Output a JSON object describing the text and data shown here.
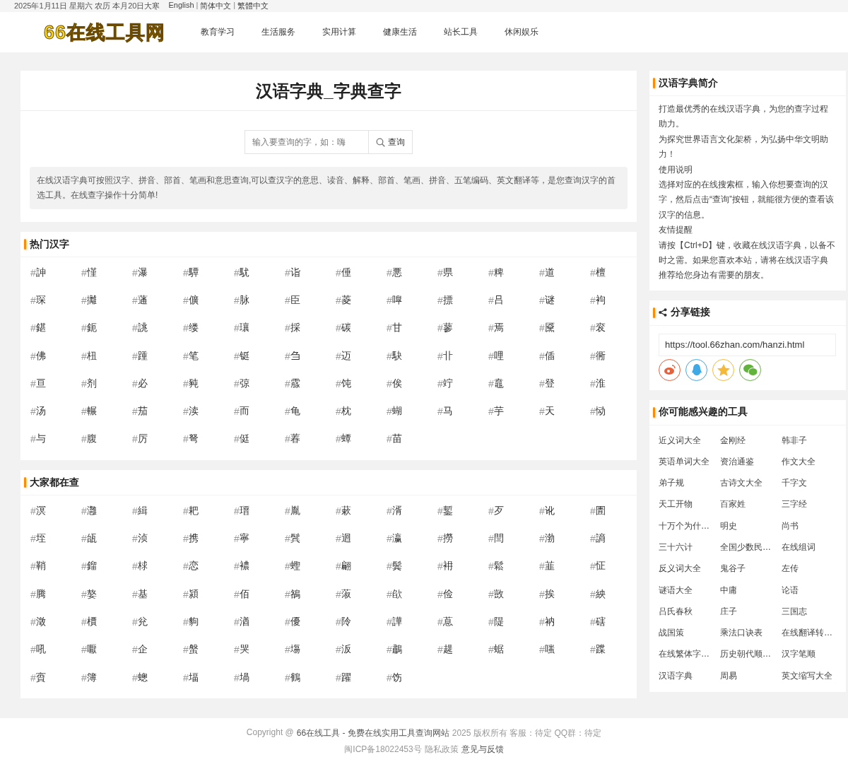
{
  "top_bar": {
    "date": "2025年1月11日 星期六 农历 本月20日大寒",
    "separator": "|",
    "languages": [
      "English",
      "简体中文",
      "繁體中文"
    ]
  },
  "header": {
    "logo": "66在线工具网",
    "nav": [
      {
        "label": "教育学习"
      },
      {
        "label": "生活服务"
      },
      {
        "label": "实用计算"
      },
      {
        "label": "健康生活"
      },
      {
        "label": "站长工具"
      },
      {
        "label": "休闲娱乐"
      }
    ]
  },
  "title_card": {
    "title": "汉语字典_字典查字",
    "search": {
      "placeholder": "输入要查询的字，如：嗨",
      "button": "查询"
    },
    "intro": "在线汉语字典可按照汉字、拼音、部首、笔画和意思查询,可以查汉字的意思、读音、解释、部首、笔画、拼音、五笔编码、英文翻译等，是您查询汉字的首选工具。在线查字操作十分简单!"
  },
  "char_sections": [
    {
      "title": "热门汉字",
      "tag_mark": "#",
      "items": [
        "訷",
        "慬",
        "瀑",
        "驔",
        "駀",
        "诣",
        "倕",
        "悪",
        "県",
        "粺",
        "道",
        "檀",
        "琛",
        "攡",
        "蓪",
        "儣",
        "脉",
        "臣",
        "菱",
        "嘷",
        "摽",
        "吕",
        "谜",
        "袧",
        "鍖",
        "鈪",
        "誂",
        "缕",
        "瓖",
        "採",
        "碳",
        "甘",
        "蓼",
        "焉",
        "黡",
        "衮",
        "佛",
        "杻",
        "踵",
        "笔",
        "铤",
        "刍",
        "迈",
        "駃",
        "卝",
        "哩",
        "偛",
        "衕",
        "亘",
        "剂",
        "必",
        "豘",
        "弶",
        "霡",
        "饨",
        "俟",
        "竚",
        "鼁",
        "登",
        "淮",
        "汤",
        "輾",
        "茄",
        "渎",
        "而",
        "龟",
        "枕",
        "蝴",
        "马",
        "芋",
        "天",
        "恸",
        "与",
        "腹",
        "厉",
        "弩",
        "侹",
        "萶",
        "蟫",
        "苗"
      ]
    },
    {
      "title": "大家都在查",
      "tag_mark": "#",
      "items": [
        "溟",
        "灉",
        "緝",
        "耙",
        "瑨",
        "胤",
        "蔌",
        "湑",
        "鏨",
        "歹",
        "讹",
        "圊",
        "垤",
        "瓵",
        "浈",
        "携",
        "寧",
        "鬂",
        "迴",
        "瀛",
        "撈",
        "閆",
        "渤",
        "謪",
        "鞘",
        "鎦",
        "梂",
        "恋",
        "襛",
        "蟶",
        "翩",
        "鬓",
        "衻",
        "鬆",
        "韮",
        "怔",
        "腾",
        "嫯",
        "基",
        "潁",
        "佰",
        "鵅",
        "蔋",
        "欿",
        "俭",
        "敳",
        "挨",
        "紻",
        "澂",
        "檟",
        "兊",
        "豿",
        "湭",
        "優",
        "阾",
        "譁",
        "蒠",
        "隄",
        "衲",
        "磍",
        "吼",
        "嚈",
        "企",
        "螌",
        "哭",
        "塲",
        "汳",
        "鷫",
        "趧",
        "蜛",
        "嗤",
        "蹀",
        "賨",
        "簿",
        "蟌",
        "堛",
        "堝",
        "鶴",
        "躍",
        "饬"
      ]
    }
  ],
  "sidebar": {
    "intro": {
      "title": "汉语字典简介",
      "paragraphs": [
        "打造最优秀的在线汉语字典，为您的查字过程助力。",
        "为探究世界语言文化架桥，为弘扬中华文明助力！",
        "使用说明",
        "选择对应的在线搜索框，输入你想要查询的汉字，然后点击“查询”按钮，就能很方便的查看该汉字的信息。",
        "友情提醒",
        "请按【Ctrl+D】键，收藏在线汉语字典，以备不时之需。如果您喜欢本站，请将在线汉语字典推荐给您身边有需要的朋友。"
      ]
    },
    "share": {
      "title": "分享链接",
      "url": "https://tool.66zhan.com/hanzi.html",
      "buttons": [
        {
          "kind": "weibo",
          "color": "#e6623c"
        },
        {
          "kind": "qq",
          "color": "#3fa8e6"
        },
        {
          "kind": "qzone",
          "color": "#f5b93a"
        },
        {
          "kind": "wechat",
          "color": "#62b33c"
        }
      ]
    },
    "tools": {
      "title": "你可能感兴趣的工具",
      "items": [
        "近义词大全",
        "金刚经",
        "韩非子",
        "英语单词大全",
        "资治通鉴",
        "作文大全",
        "弟子规",
        "古诗文大全",
        "千字文",
        "天工开物",
        "百家姓",
        "三字经",
        "十万个为什…",
        "明史",
        "尚书",
        "三十六计",
        "全国少数民…",
        "在线组词",
        "反义词大全",
        "鬼谷子",
        "左传",
        "谜语大全",
        "中庸",
        "论语",
        "吕氏春秋",
        "庄子",
        "三国志",
        "战国策",
        "乘法口诀表",
        "在线翻译转…",
        "在线繁体字…",
        "历史朝代顺…",
        "汉字笔顺",
        "汉语字典",
        "周易",
        "英文缩写大全"
      ]
    }
  },
  "footer": {
    "lines": [
      [
        {
          "text": "Copyright @",
          "kind": "muted"
        },
        {
          "text": "66在线工具 - 免费在线实用工具查询网站",
          "kind": "link"
        },
        {
          "text": "2025 版权所有 客服：待定 QQ群：待定",
          "kind": "muted"
        }
      ],
      [
        {
          "text": "闽ICP备18022453号",
          "kind": "muted"
        },
        {
          "text": "隐私政策",
          "kind": "muted"
        },
        {
          "text": "意见与反馈",
          "kind": "link"
        }
      ]
    ]
  }
}
